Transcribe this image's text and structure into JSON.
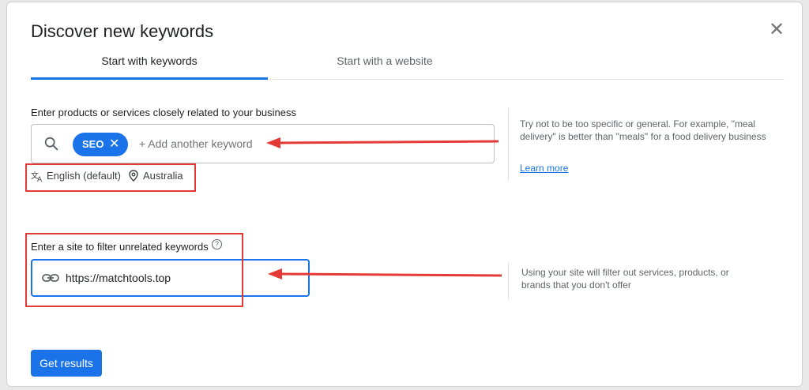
{
  "dialog": {
    "title": "Discover new keywords",
    "close_icon": "close-icon"
  },
  "tabs": [
    {
      "label": "Start with keywords",
      "active": true
    },
    {
      "label": "Start with a website",
      "active": false
    }
  ],
  "keywords": {
    "label": "Enter products or services closely related to your business",
    "chip": "SEO",
    "placeholder": "+ Add another keyword",
    "language": "English (default)",
    "location": "Australia",
    "hint": "Try not to be too specific or general. For example, \"meal delivery\" is better than \"meals\" for a food delivery business",
    "learn_more": "Learn more"
  },
  "site": {
    "label": "Enter a site to filter unrelated keywords",
    "help_icon": "?",
    "value": "https://matchtools.top",
    "hint": "Using your site will filter out services, products, or brands that you don't offer"
  },
  "actions": {
    "get_results": "Get results"
  },
  "colors": {
    "accent": "#1a73e8",
    "annotation": "#e53935"
  }
}
